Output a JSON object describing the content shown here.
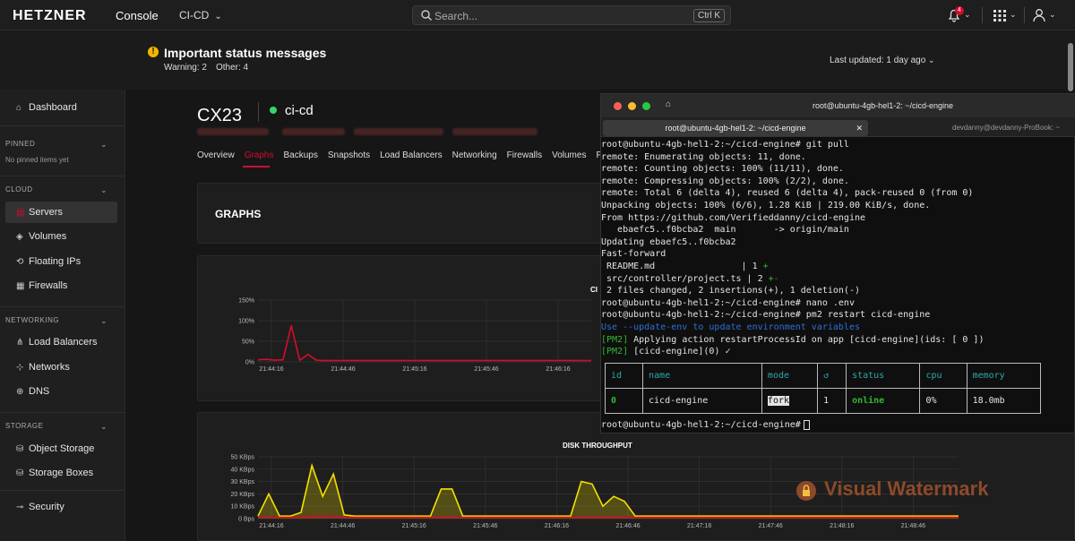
{
  "topbar": {
    "logo": "HETZNER",
    "logo_sub": "Console",
    "project": "CI-CD",
    "search_placeholder": "Search...",
    "search_shortcut": "Ctrl K",
    "notification_count": "4"
  },
  "banner": {
    "title": "Important status messages",
    "warning": "Warning: 2",
    "other": "Other: 4",
    "last_updated": "Last updated: 1 day ago"
  },
  "sidebar": {
    "dashboard": "Dashboard",
    "pinned_label": "PINNED",
    "pinned_note": "No pinned items yet",
    "cloud_label": "CLOUD",
    "servers": "Servers",
    "volumes": "Volumes",
    "floating_ips": "Floating IPs",
    "firewalls": "Firewalls",
    "networking_label": "NETWORKING",
    "load_balancers": "Load Balancers",
    "networks": "Networks",
    "dns": "DNS",
    "storage_label": "STORAGE",
    "object_storage": "Object Storage",
    "storage_boxes": "Storage Boxes",
    "security": "Security"
  },
  "server": {
    "type": "CX23",
    "name": "ci-cd",
    "tabs": [
      "Overview",
      "Graphs",
      "Backups",
      "Snapshots",
      "Load Balancers",
      "Networking",
      "Firewalls",
      "Volumes",
      "Power"
    ],
    "active_tab": "Graphs"
  },
  "graphs": {
    "title": "GRAPHS",
    "cpu_partial_title": "CI",
    "disk_title": "DISK THROUGHPUT"
  },
  "chart_data": [
    {
      "type": "line",
      "title": "",
      "x_ticks": [
        "21:44:16",
        "21:44:46",
        "21:45:16",
        "21:45:46",
        "21:46:16"
      ],
      "y_ticks": [
        "0%",
        "50%",
        "100%",
        "150%"
      ],
      "ylim": [
        0,
        150
      ],
      "series": [
        {
          "color": "#d50c2d",
          "values": [
            5,
            6,
            4,
            5,
            88,
            4,
            18,
            4,
            3,
            3,
            3,
            3,
            3,
            3,
            3,
            3,
            3,
            3,
            3,
            3,
            3,
            3,
            3,
            3,
            3,
            3,
            3,
            3,
            3,
            3,
            3,
            3,
            3,
            3,
            3,
            3,
            3,
            3,
            3,
            3,
            3
          ]
        }
      ]
    },
    {
      "type": "area",
      "title": "DISK THROUGHPUT",
      "x_ticks": [
        "21:44:16",
        "21:44:46",
        "21:45:16",
        "21:45:46",
        "21:46:16",
        "21:46:46",
        "21:47:16",
        "21:47:46",
        "21:48:16",
        "21:48:46"
      ],
      "y_ticks": [
        "0 Bps",
        "10 KBps",
        "20 KBps",
        "30 KBps",
        "40 KBps",
        "50 KBps"
      ],
      "ylim": [
        0,
        50
      ],
      "series": [
        {
          "color": "#f5e000",
          "values": [
            2,
            20,
            2,
            2,
            5,
            43,
            18,
            36,
            3,
            2,
            2,
            2,
            2,
            2,
            2,
            2,
            2,
            24,
            24,
            2,
            2,
            2,
            2,
            2,
            2,
            2,
            2,
            2,
            2,
            2,
            30,
            28,
            10,
            18,
            14,
            2,
            2,
            2,
            2,
            2,
            2,
            2,
            2,
            2,
            2,
            2,
            2,
            2,
            2,
            2,
            2,
            2,
            2,
            2,
            2,
            2,
            2,
            2,
            2,
            2,
            2,
            2,
            2,
            2,
            2,
            2
          ]
        },
        {
          "color": "#d50c2d",
          "values": [
            1,
            1,
            1,
            1,
            1,
            2,
            2,
            2,
            1,
            1,
            1,
            1,
            1,
            1,
            1,
            1,
            1,
            1,
            1,
            1,
            1,
            1,
            1,
            1,
            1,
            1,
            1,
            1,
            1,
            1,
            1,
            1,
            1,
            1,
            1,
            1,
            1,
            1,
            1,
            1,
            1,
            1,
            1,
            1,
            1,
            1,
            1,
            1,
            1,
            1,
            1,
            1,
            1,
            1,
            1,
            1,
            1,
            1,
            1,
            1,
            1,
            1,
            1,
            1,
            1,
            1
          ]
        }
      ]
    }
  ],
  "terminal": {
    "window_title": "root@ubuntu-4gb-hel1-2: ~/cicd-engine",
    "tab_active": "root@ubuntu-4gb-hel1-2: ~/cicd-engine",
    "tab_other": "devdanny@devdanny-ProBook: ~",
    "lines": [
      "root@ubuntu-4gb-hel1-2:~/cicd-engine# git pull",
      "remote: Enumerating objects: 11, done.",
      "remote: Counting objects: 100% (11/11), done.",
      "remote: Compressing objects: 100% (2/2), done.",
      "remote: Total 6 (delta 4), reused 6 (delta 4), pack-reused 0 (from 0)",
      "Unpacking objects: 100% (6/6), 1.28 KiB | 219.00 KiB/s, done.",
      "From https://github.com/Verifieddanny/cicd-engine",
      "   ebaefc5..f0bcba2  main       -> origin/main",
      "Updating ebaefc5..f0bcba2",
      "Fast-forward",
      " README.md                | 1 ",
      " src/controller/project.ts | 2 ",
      " 2 files changed, 2 insertions(+), 1 deletion(-)",
      "root@ubuntu-4gb-hel1-2:~/cicd-engine# nano .env",
      "root@ubuntu-4gb-hel1-2:~/cicd-engine# pm2 restart cicd-engine",
      "Use --update-env to update environment variables",
      " Applying action restartProcessId on app [cicd-engine](ids: [ 0 ])",
      " [cicd-engine](0) ✓"
    ],
    "diff_readme": "+",
    "diff_project_add": "+",
    "diff_project_del": "-",
    "pm2_tag": "[PM2]",
    "table_headers": [
      "id",
      "name",
      "mode",
      "↺",
      "status",
      "cpu",
      "memory"
    ],
    "table_row": [
      "0",
      "cicd-engine",
      "fork",
      "1",
      "online",
      "0%",
      "18.0mb"
    ],
    "prompt": "root@ubuntu-4gb-hel1-2:~/cicd-engine#"
  },
  "watermark": "Visual Watermark"
}
